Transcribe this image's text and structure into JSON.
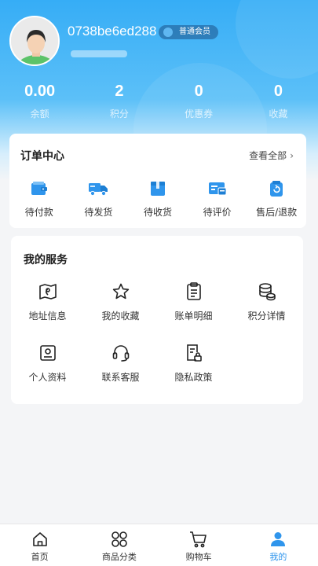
{
  "profile": {
    "username": "0738be6ed288",
    "member_badge": "普通会员"
  },
  "stats": [
    {
      "value": "0.00",
      "label": "余额"
    },
    {
      "value": "2",
      "label": "积分"
    },
    {
      "value": "0",
      "label": "优惠券"
    },
    {
      "value": "0",
      "label": "收藏"
    }
  ],
  "orders": {
    "title": "订单中心",
    "view_all": "查看全部",
    "items": [
      {
        "label": "待付款",
        "icon": "wallet-icon"
      },
      {
        "label": "待发货",
        "icon": "truck-icon"
      },
      {
        "label": "待收货",
        "icon": "package-icon"
      },
      {
        "label": "待评价",
        "icon": "review-icon"
      },
      {
        "label": "售后/退款",
        "icon": "refund-icon"
      }
    ]
  },
  "services": {
    "title": "我的服务",
    "items": [
      {
        "label": "地址信息",
        "icon": "map-icon"
      },
      {
        "label": "我的收藏",
        "icon": "star-icon"
      },
      {
        "label": "账单明细",
        "icon": "clipboard-icon"
      },
      {
        "label": "积分详情",
        "icon": "coins-icon"
      },
      {
        "label": "个人资料",
        "icon": "profile-card-icon"
      },
      {
        "label": "联系客服",
        "icon": "headset-icon"
      },
      {
        "label": "隐私政策",
        "icon": "privacy-document-icon"
      }
    ]
  },
  "tabbar": {
    "items": [
      {
        "label": "首页",
        "icon": "home-icon"
      },
      {
        "label": "商品分类",
        "icon": "category-grid-icon"
      },
      {
        "label": "购物车",
        "icon": "cart-icon"
      },
      {
        "label": "我的",
        "icon": "user-icon"
      }
    ],
    "active_index": 3
  },
  "colors": {
    "header_blue": "#36adf6",
    "accent_blue": "#2f95ec",
    "background": "#f4f5f7"
  }
}
